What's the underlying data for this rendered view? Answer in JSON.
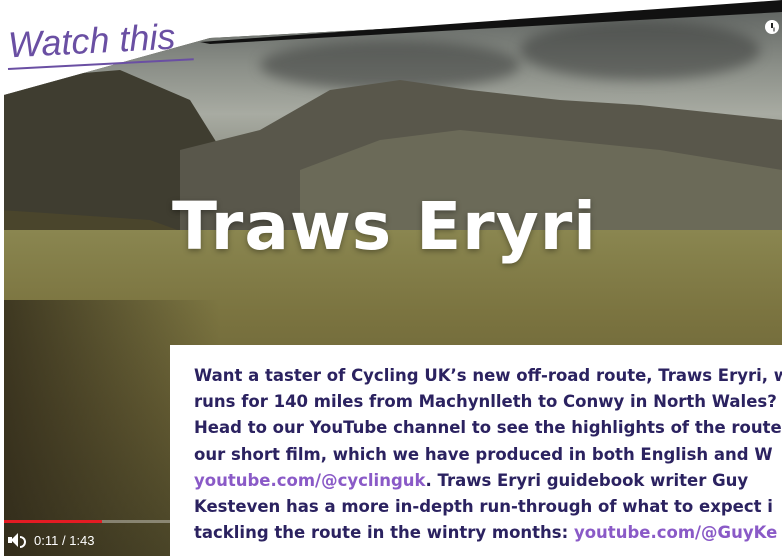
{
  "label": {
    "text": "Watch this",
    "color": "#6a4fa3"
  },
  "video": {
    "title_overlay": "Traws Eryri",
    "time_current": "0:11",
    "time_separator": "/",
    "time_total": "1:43",
    "progress_fraction": 0.107,
    "icons": {
      "volume": "volume-icon",
      "watch_later": "clock-icon"
    },
    "progress_color": "#e31b23"
  },
  "card": {
    "lines": [
      "Want a taster of Cycling UK’s new off-road route, Traws Eryri, w",
      "runs for 140 miles from Machynlleth to Conwy in North Wales?",
      "Head to our YouTube channel to see the highlights of the route",
      "our short film, which we have produced in both English and W"
    ],
    "link1": "youtube.com/@cyclinguk",
    "line5_rest": ". Traws Eryri guidebook writer Guy",
    "line6": "Kesteven has a more in-depth run-through of what to expect i",
    "line7_start": "tackling the route in the wintry months: ",
    "link2": "youtube.com/@GuyKe",
    "text_color": "#2b2260",
    "link_color": "#8a5ac7"
  }
}
